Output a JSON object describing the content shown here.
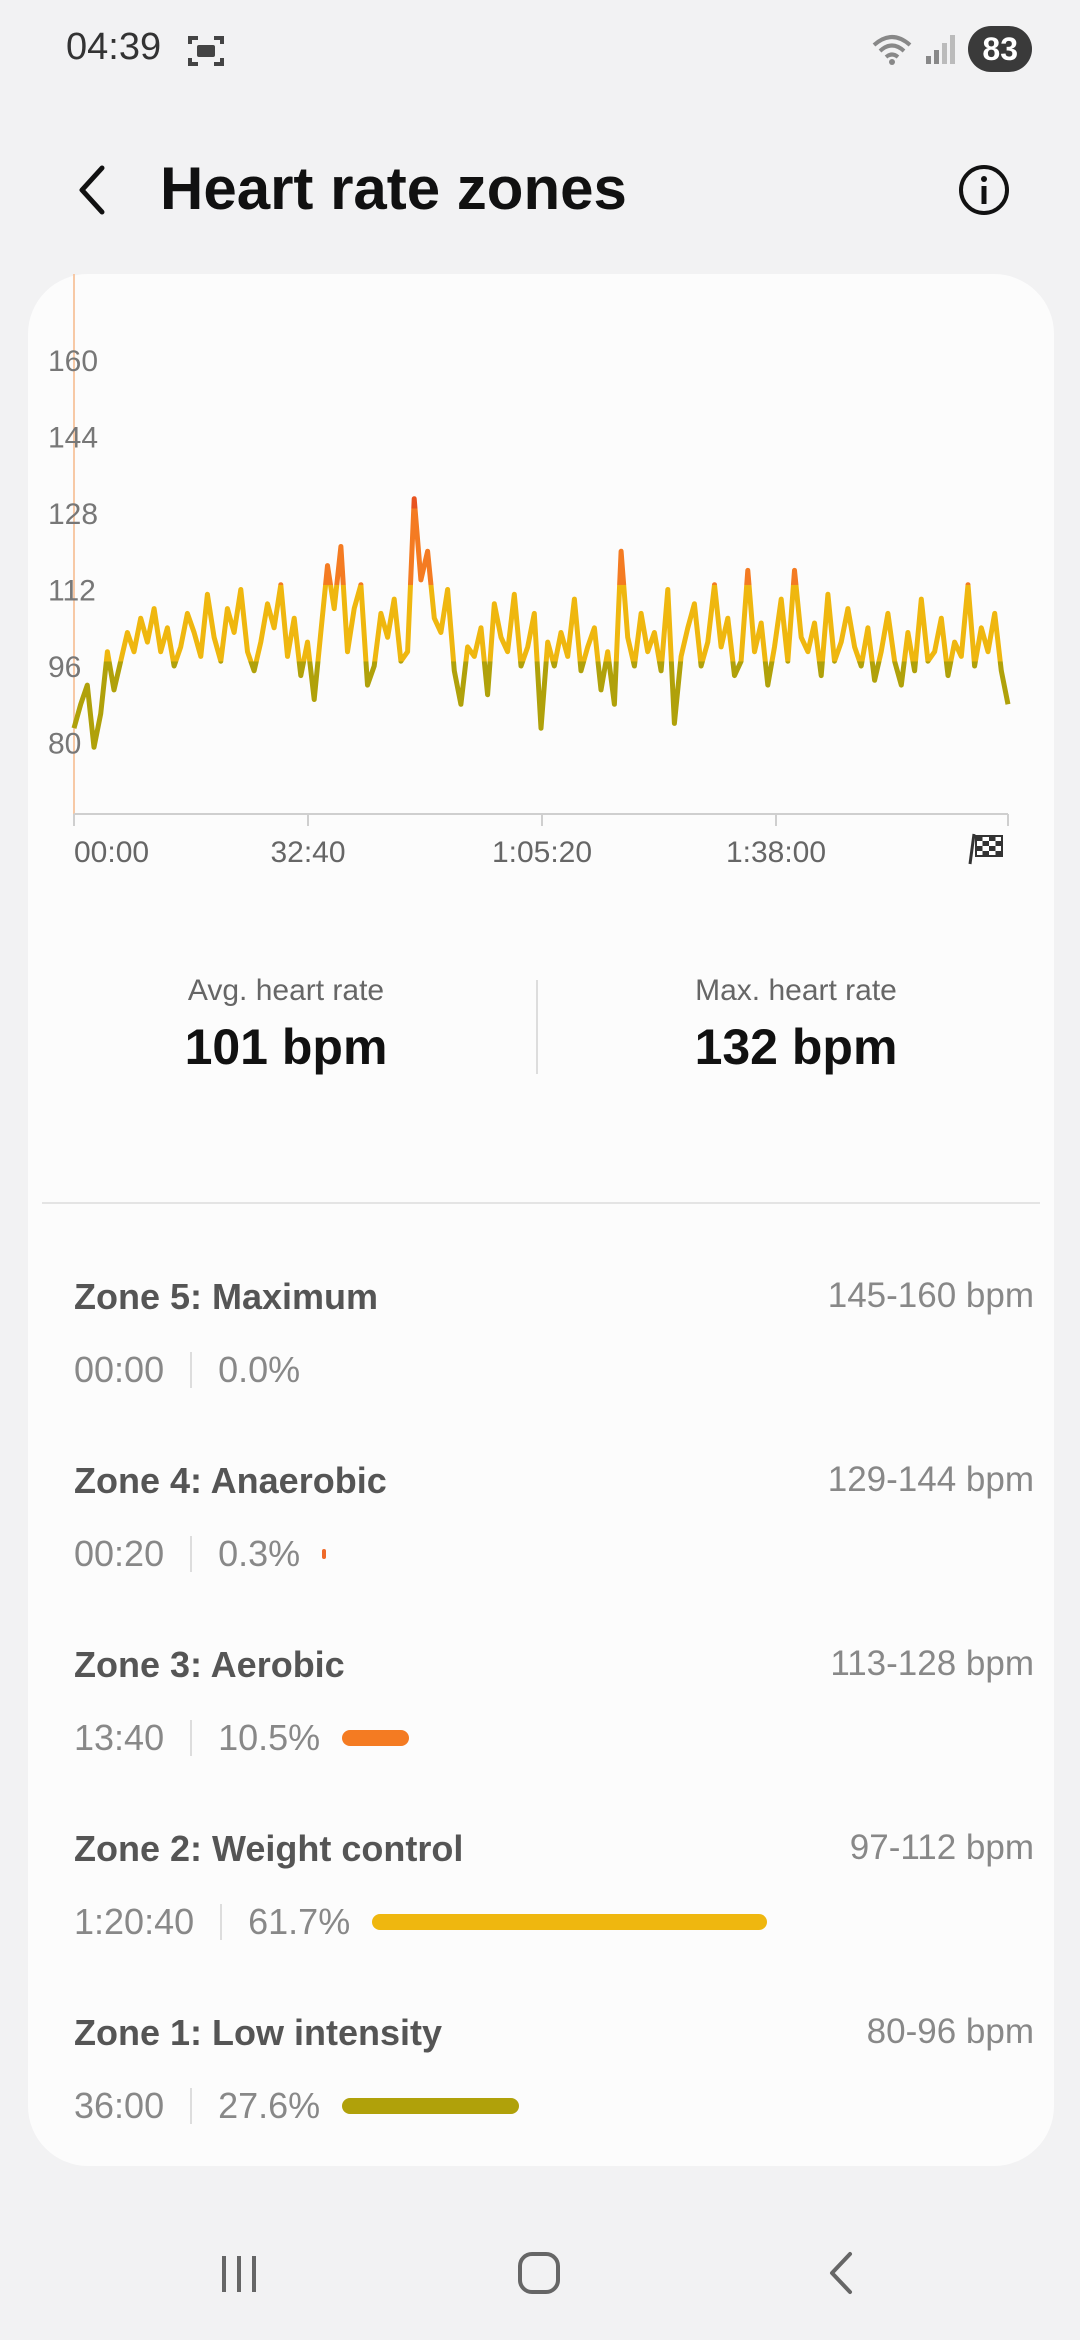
{
  "status_bar": {
    "time": "04:39",
    "battery": "83",
    "icons": [
      "screenshot-icon",
      "wifi-icon",
      "signal-icon"
    ]
  },
  "header": {
    "title": "Heart rate zones",
    "back_icon": "back-arrow-icon",
    "info_icon": "info-icon"
  },
  "chart_data": {
    "type": "line",
    "yticks": [
      "160",
      "144",
      "128",
      "112",
      "96",
      "80"
    ],
    "ylim": [
      80,
      160
    ],
    "xticks": [
      "00:00",
      "32:40",
      "1:05:20",
      "1:38:00"
    ],
    "x_end_icon": "finish-flag-icon",
    "series": [
      {
        "x": [
          0,
          1,
          2,
          3,
          4,
          5,
          6,
          7,
          8,
          9,
          10,
          11,
          12,
          13,
          14,
          15,
          16,
          17,
          18,
          19,
          20,
          21,
          22,
          23,
          24,
          25,
          26,
          27,
          28,
          29,
          30,
          31,
          32,
          33,
          34,
          35,
          36,
          37,
          38,
          39,
          40,
          41,
          42,
          43,
          44,
          45,
          46,
          47,
          48,
          49,
          50,
          51,
          52,
          53,
          54,
          55,
          56,
          57,
          58,
          59,
          60,
          61,
          62,
          63,
          64,
          65,
          66,
          67,
          68,
          69,
          70,
          71,
          72,
          73,
          74,
          75,
          76,
          77,
          78,
          79,
          80,
          81,
          82,
          83,
          84,
          85,
          86,
          87,
          88,
          89,
          90,
          91,
          92,
          93,
          94,
          95,
          96,
          97,
          98,
          99,
          100,
          101,
          102,
          103,
          104,
          105,
          106,
          107,
          108,
          109,
          110,
          111,
          112,
          113,
          114,
          115,
          116,
          117,
          118,
          119,
          120,
          121,
          122,
          123,
          124,
          125,
          126,
          127,
          128,
          129,
          130,
          131,
          132,
          133,
          134,
          135,
          136,
          137,
          138,
          139,
          140
        ],
        "values": [
          83,
          88,
          92,
          79,
          86,
          99,
          91,
          97,
          103,
          99,
          106,
          101,
          108,
          99,
          104,
          96,
          100,
          107,
          103,
          98,
          111,
          102,
          97,
          108,
          103,
          112,
          99,
          95,
          101,
          109,
          104,
          113,
          98,
          106,
          94,
          101,
          89,
          103,
          117,
          108,
          121,
          99,
          108,
          113,
          92,
          96,
          107,
          102,
          110,
          97,
          99,
          131,
          114,
          120,
          106,
          103,
          112,
          95,
          88,
          100,
          98,
          104,
          90,
          109,
          102,
          99,
          111,
          96,
          100,
          107,
          83,
          101,
          96,
          103,
          98,
          110,
          95,
          100,
          104,
          91,
          99,
          88,
          120,
          102,
          96,
          107,
          99,
          103,
          95,
          112,
          84,
          98,
          104,
          109,
          96,
          101,
          113,
          100,
          106,
          94,
          97,
          116,
          99,
          105,
          92,
          100,
          110,
          97,
          116,
          102,
          99,
          105,
          94,
          111,
          97,
          101,
          108,
          100,
          96,
          104,
          93,
          99,
          107,
          97,
          92,
          103,
          95,
          110,
          97,
          99,
          106,
          94,
          101,
          98,
          113,
          96,
          104,
          99,
          107,
          95,
          88
        ]
      }
    ]
  },
  "stats": {
    "avg_label": "Avg. heart rate",
    "avg_value": "101 bpm",
    "max_label": "Max. heart rate",
    "max_value": "132 bpm"
  },
  "zones": [
    {
      "name": "Zone 5: Maximum",
      "range": "145-160 bpm",
      "time": "00:00",
      "percent": "0.0%",
      "fraction": 0.0,
      "color": "#e8531f"
    },
    {
      "name": "Zone 4: Anaerobic",
      "range": "129-144 bpm",
      "time": "00:20",
      "percent": "0.3%",
      "fraction": 0.003,
      "color": "#ef6a2a"
    },
    {
      "name": "Zone 3: Aerobic",
      "range": "113-128 bpm",
      "time": "13:40",
      "percent": "10.5%",
      "fraction": 0.105,
      "color": "#f47b22"
    },
    {
      "name": "Zone 2: Weight control",
      "range": "97-112 bpm",
      "time": "1:20:40",
      "percent": "61.7%",
      "fraction": 0.617,
      "color": "#efb70f"
    },
    {
      "name": "Zone 1: Low intensity",
      "range": "80-96 bpm",
      "time": "36:00",
      "percent": "27.6%",
      "fraction": 0.276,
      "color": "#b0a10a"
    }
  ],
  "navbar": {
    "recent_icon": "recent-apps-icon",
    "home_icon": "home-icon",
    "back_icon": "back-icon"
  }
}
